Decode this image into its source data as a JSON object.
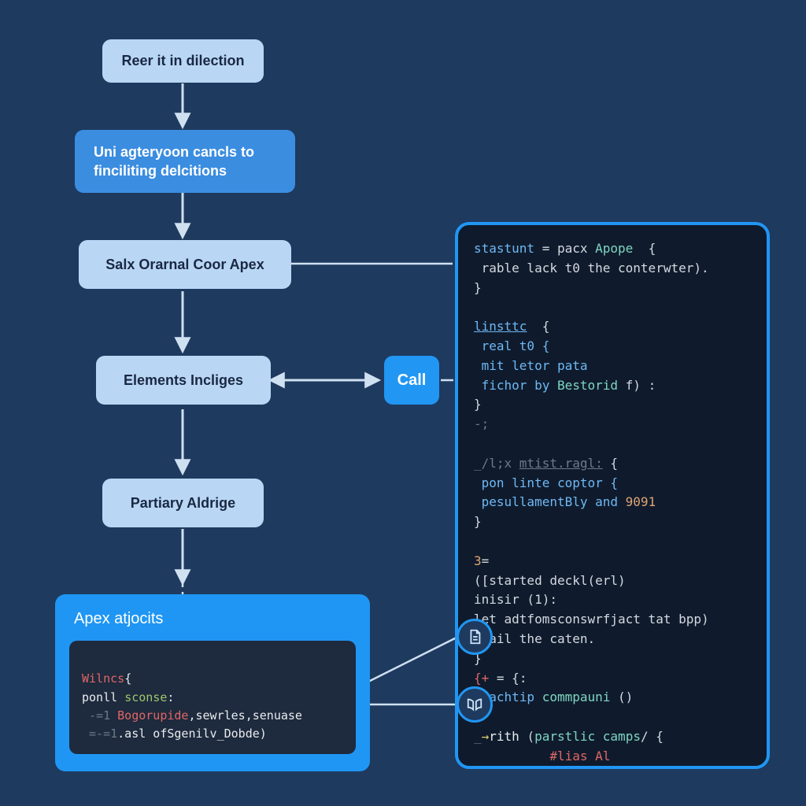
{
  "nodes": {
    "n1": "Reer it in dilection",
    "n2": "Uni agteryoon cancls to finciliting delcitions",
    "n3": "Salx Orarnal Coor Apex",
    "n4": "Elements Incliges",
    "n5": "Partiary Aldrige",
    "n6": "Apex atjocits",
    "call": "Call"
  },
  "inner_code": {
    "l1a": "Wilncs",
    "l1b": "{",
    "l2a": "ponll",
    "l2b": "sconse",
    "l2c": ":",
    "l3a": " -=1",
    "l3b": "Bogorupide",
    "l3c": ",sewrles,senuase",
    "l4a": " =-=1",
    "l4b": ".asl ofSgenilv_Dobde)"
  },
  "panel": {
    "p1a": "stastunt",
    "p1b": " = pacx ",
    "p1c": "Apope",
    "p1d": "  {",
    "p2": " rable lack t0 the conterwter).",
    "p3": "}",
    "p4a": "linsttc",
    "p4b": "  {",
    "p5": " real t0 {",
    "p6": " mit letor pata",
    "p7a": " fichor by ",
    "p7b": "Bestorid",
    "p7c": " f) :",
    "p8": "}",
    "p8b": "-;",
    "p9a": "_/l;x ",
    "p9b": "mtist.ragl:",
    "p9c": " {",
    "p10": " pon linte coptor {",
    "p11a": " pesullamentBly and ",
    "p11b": "9091",
    "p12": "}",
    "p13a": "3",
    "p13b": "=",
    "p14": "([started deckl(erl)",
    "p15": "inisir (1):",
    "p16": "let adtfomsconswrfjact tat bpp)",
    "p17": "a ail the caten.",
    "p18": "}",
    "p19a": "{",
    "p19b": "+",
    "p19c": " = {:",
    "p20a": " fachtip ",
    "p20b": "commpauni",
    "p20c": " ()",
    "p21a": "_",
    "p21b": "→",
    "p21c": "rith ",
    "p21d": "(",
    "p21e": "parstlic camps",
    "p21f": "/ {",
    "p22a": "          ",
    "p22b": "#lias Al"
  }
}
